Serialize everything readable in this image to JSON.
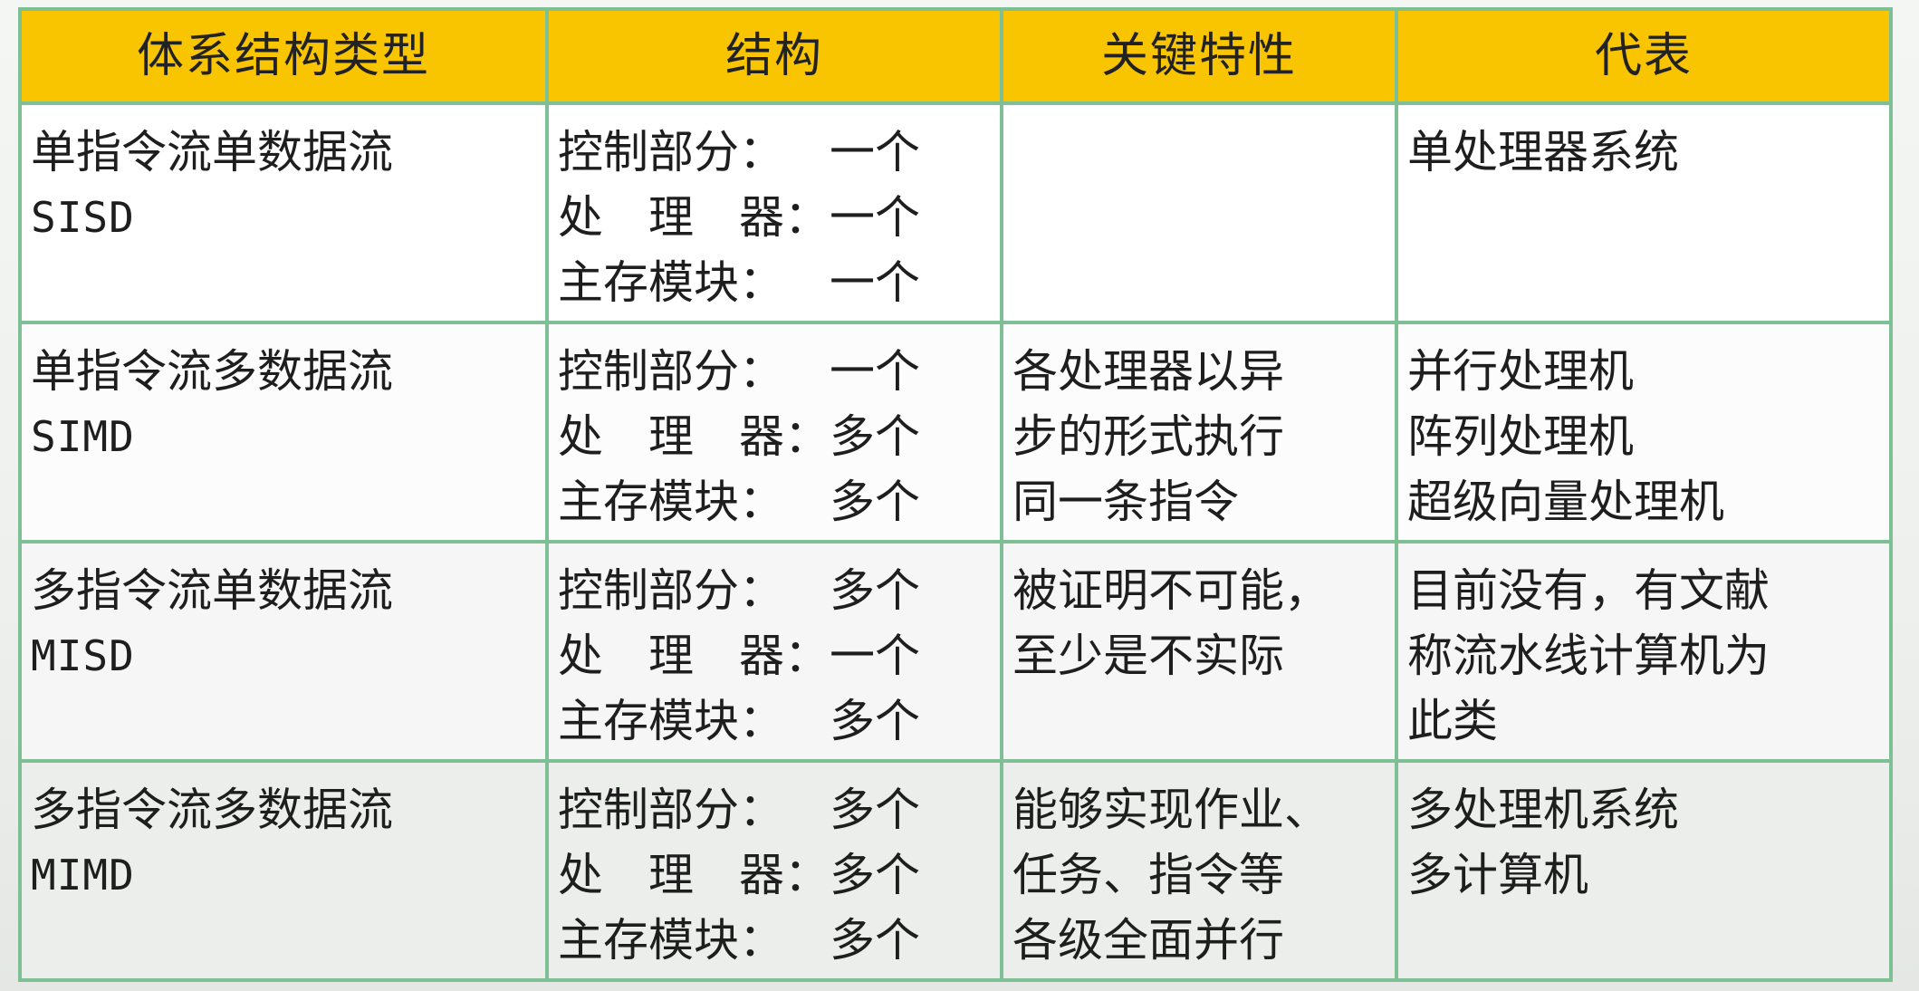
{
  "table": {
    "headers": [
      "体系结构类型",
      "结构",
      "关键特性",
      "代表"
    ],
    "rows": [
      {
        "type_name": "单指令流单数据流",
        "type_code": "SISD",
        "structure": [
          {
            "label": "控制部分：",
            "value": "一个"
          },
          {
            "label": "处　理　器：",
            "value": "一个"
          },
          {
            "label": "主存模块：",
            "value": "一个"
          }
        ],
        "features": [],
        "representatives": [
          "单处理器系统"
        ]
      },
      {
        "type_name": "单指令流多数据流",
        "type_code": "SIMD",
        "structure": [
          {
            "label": "控制部分：",
            "value": "一个"
          },
          {
            "label": "处　理　器：",
            "value": "多个"
          },
          {
            "label": "主存模块：",
            "value": "多个"
          }
        ],
        "features": [
          "各处理器以异",
          "步的形式执行",
          "同一条指令"
        ],
        "representatives": [
          "并行处理机",
          "阵列处理机",
          "超级向量处理机"
        ]
      },
      {
        "type_name": "多指令流单数据流",
        "type_code": "MISD",
        "structure": [
          {
            "label": "控制部分：",
            "value": "多个"
          },
          {
            "label": "处　理　器：",
            "value": "一个"
          },
          {
            "label": "主存模块：",
            "value": "多个"
          }
        ],
        "features": [
          "被证明不可能，",
          "至少是不实际"
        ],
        "representatives": [
          "目前没有，有文献",
          "称流水线计算机为",
          "此类"
        ]
      },
      {
        "type_name": "多指令流多数据流",
        "type_code": "MIMD",
        "structure": [
          {
            "label": "控制部分：",
            "value": "多个"
          },
          {
            "label": "处　理　器：",
            "value": "多个"
          },
          {
            "label": "主存模块：",
            "value": "多个"
          }
        ],
        "features": [
          "能够实现作业、",
          "任务、指令等",
          "各级全面并行"
        ],
        "representatives": [
          "多处理机系统",
          "多计算机"
        ]
      }
    ]
  }
}
